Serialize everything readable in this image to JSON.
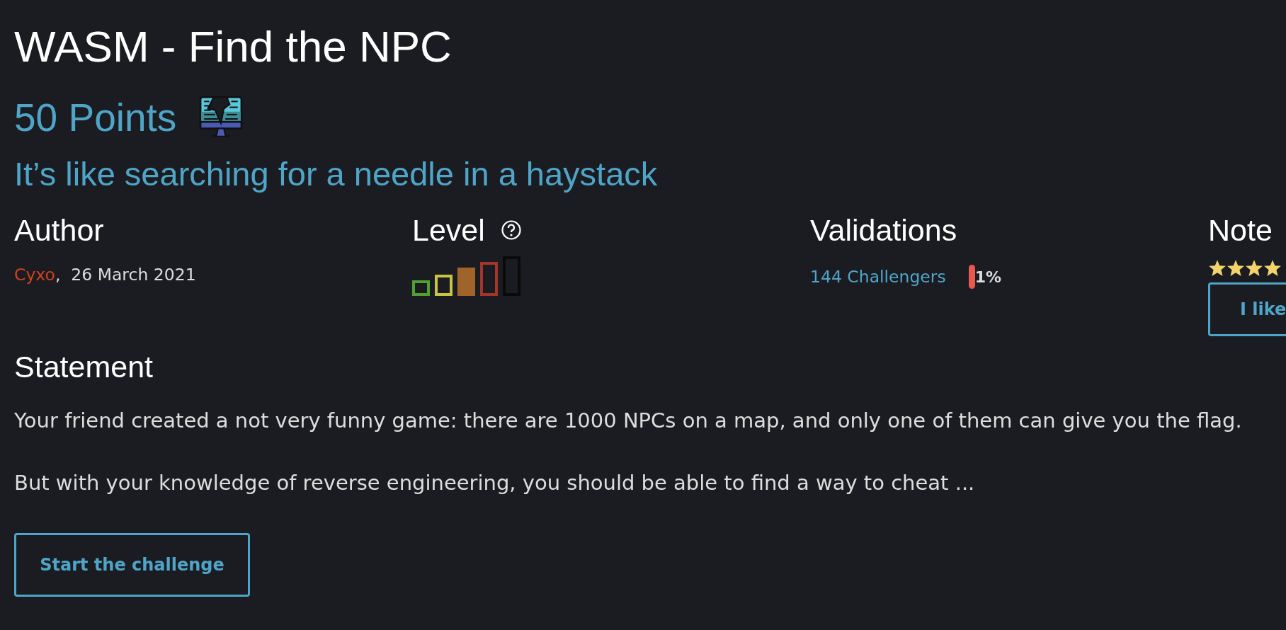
{
  "title": "WASM - Find the NPC",
  "points": "50 Points",
  "subtitle": "It’s like searching for a needle in a haystack",
  "author": {
    "heading": "Author",
    "name": "Cyxo",
    "date": ",  26 March 2021"
  },
  "difficulty": {
    "heading": "Level",
    "bars": [
      {
        "color": "#4ea12e",
        "filled": false
      },
      {
        "color": "#c9c43f",
        "filled": false
      },
      {
        "color": "#a0632a",
        "filled": true
      },
      {
        "color": "#a3352a",
        "filled": false
      },
      {
        "color": "#0a0a0a",
        "filled": false
      }
    ]
  },
  "validations": {
    "heading": "Validations",
    "challengers": "144 Challengers",
    "percent": "1%"
  },
  "note": {
    "heading": "Note",
    "stars": 4,
    "button": "I like"
  },
  "statement": {
    "heading": "Statement",
    "paragraphs": [
      "Your friend created a not very funny game: there are 1000 NPCs on a map, and only one of them can give you the flag.",
      "But with your knowledge of reverse engineering, you should be able to find a way to cheat ..."
    ]
  },
  "start_button": "Start the challenge"
}
